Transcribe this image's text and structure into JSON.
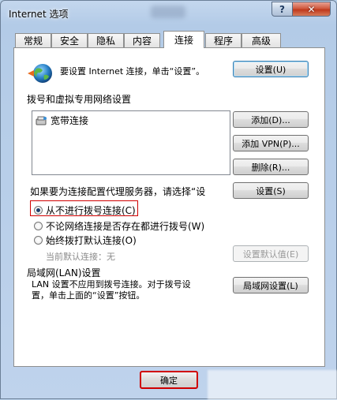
{
  "window": {
    "title": "Internet 选项",
    "help_label": "?",
    "close_label": "✕"
  },
  "tabs": [
    {
      "label": "常规"
    },
    {
      "label": "安全"
    },
    {
      "label": "隐私"
    },
    {
      "label": "内容"
    },
    {
      "label": "连接"
    },
    {
      "label": "程序"
    },
    {
      "label": "高级"
    }
  ],
  "setup": {
    "text": "要设置 Internet 连接，单击“设置”。",
    "button": "设置(U)"
  },
  "dialup": {
    "section_label": "拨号和虚拟专用网络设置",
    "connections": [
      "宽带连接"
    ],
    "add_button": "添加(D)...",
    "add_vpn_button": "添加 VPN(P)...",
    "delete_button": "删除(R)...",
    "proxy_text": "如果要为连接配置代理服务器，请选择“设",
    "settings_button": "设置(S)",
    "options": [
      {
        "label": "从不进行拨号连接(C)",
        "selected": true
      },
      {
        "label": "不论网络连接是否存在都进行拨号(W)",
        "selected": false
      },
      {
        "label": "始终拨打默认连接(O)",
        "selected": false
      }
    ],
    "current_default_label": "当前默认连接：",
    "current_default_value": "无",
    "set_default_button": "设置默认值(E)"
  },
  "lan": {
    "section_label": "局域网(LAN)设置",
    "text_line1": "LAN 设置不应用到拨号连接。对于拨号设",
    "text_line2": "置，单击上面的“设置”按钮。",
    "button": "局域网设置(L)"
  },
  "footer": {
    "ok_button": "确定"
  },
  "colors": {
    "accent_red": "#d00000"
  }
}
